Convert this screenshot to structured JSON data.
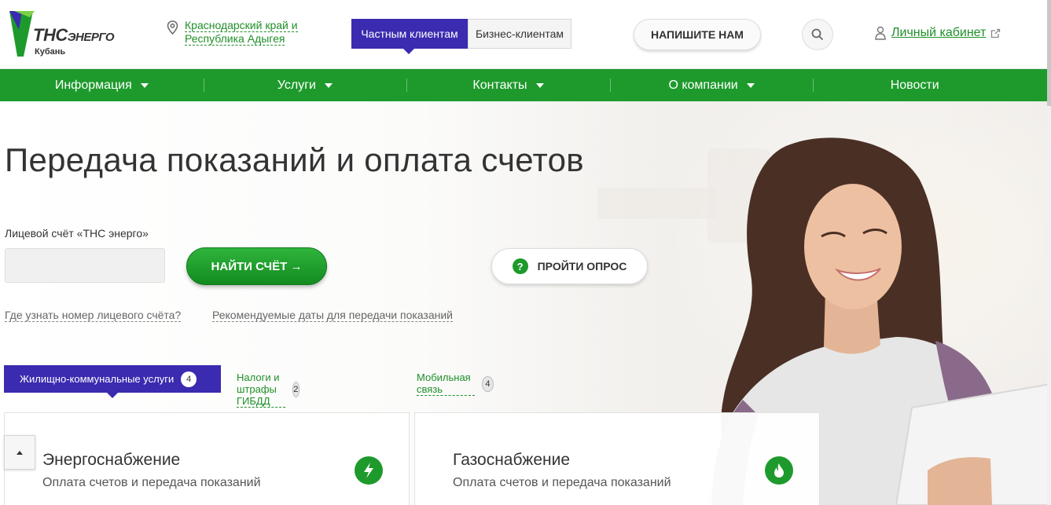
{
  "logo": {
    "brand": "ТНС",
    "brand_suffix": "ЭНЕРГО",
    "region": "Кубань"
  },
  "header": {
    "region_line1": "Краснодарский край и",
    "region_line2": "Республика Адыгея",
    "tab_private": "Частным клиентам",
    "tab_business": "Бизнес-клиентам",
    "write_us": "НАПИШИТЕ НАМ",
    "cabinet": "Личный кабинет"
  },
  "nav": [
    {
      "label": "Информация",
      "dropdown": true
    },
    {
      "label": "Услуги",
      "dropdown": true
    },
    {
      "label": "Контакты",
      "dropdown": true
    },
    {
      "label": "О компании",
      "dropdown": true
    },
    {
      "label": "Новости",
      "dropdown": false
    }
  ],
  "hero": {
    "title": "Передача показаний и оплата счетов",
    "account_label": "Лицевой счёт «ТНС энерго»",
    "account_value": "",
    "find_button": "НАЙТИ СЧЁТ →",
    "survey_button": "ПРОЙТИ ОПРОС",
    "survey_icon": "?",
    "link_where": "Где узнать номер лицевого счёта?",
    "link_dates": "Рекомендуемые даты для передачи показаний"
  },
  "service_tabs": [
    {
      "label": "Жилищно-коммунальные услуги",
      "count": "4",
      "active": true
    },
    {
      "label": "Налоги и штрафы ГИБДД",
      "count": "2",
      "active": false
    },
    {
      "label": "Мобильная связь",
      "count": "4",
      "active": false
    }
  ],
  "cards": [
    {
      "title": "Энергоснабжение",
      "subtitle": "Оплата счетов и передача показаний",
      "icon": "lightning-icon"
    },
    {
      "title": "Газоснабжение",
      "subtitle": "Оплата счетов и передача показаний",
      "icon": "flame-icon"
    }
  ],
  "colors": {
    "brand_green": "#1e9a2c",
    "accent_purple": "#3a2bb0",
    "link_green": "#1f8f29"
  }
}
